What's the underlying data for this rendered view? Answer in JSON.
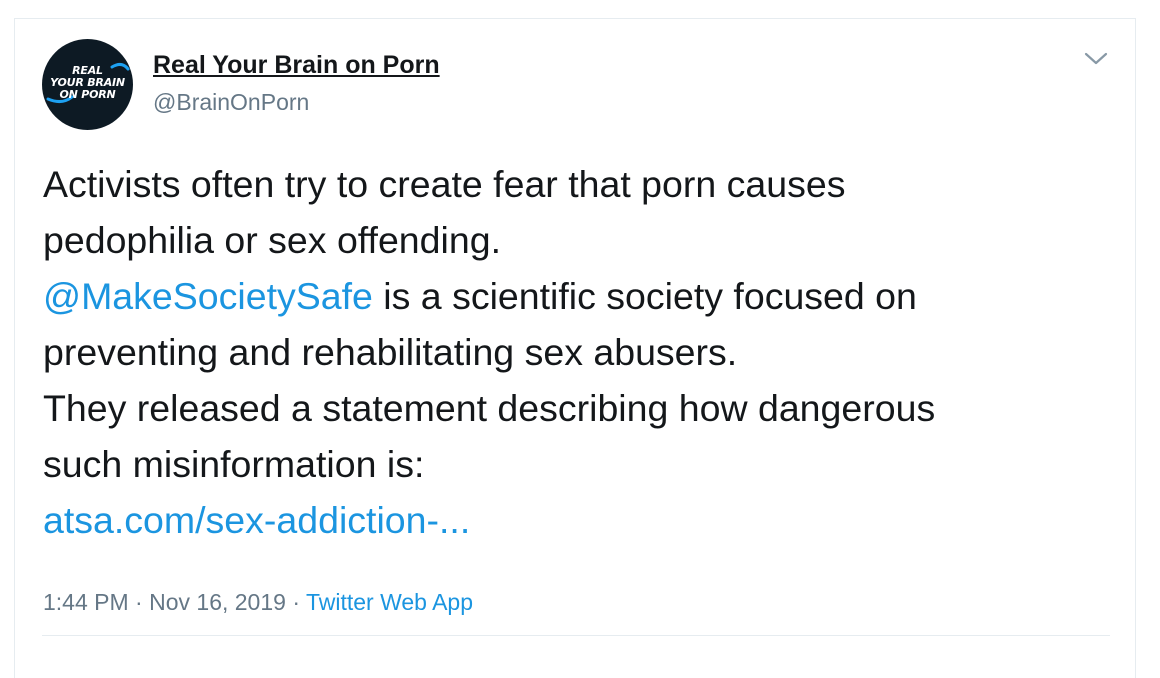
{
  "user": {
    "avatar_text_lines": [
      "REAL",
      "YOUR BRAIN",
      "ON PORN"
    ],
    "display_name": "Real Your Brain on Porn",
    "handle": "@BrainOnPorn"
  },
  "tweet": {
    "line1": "Activists often try to create fear that porn causes",
    "line2": "pedophilia or sex offending.",
    "mention": "@MakeSocietySafe",
    "line3_rest": " is a scientific society focused on",
    "line4": "preventing and rehabilitating sex abusers.",
    "line5": "They released a statement describing how dangerous",
    "line6": "such misinformation is:",
    "link": "atsa.com/sex-addiction-..."
  },
  "meta": {
    "time": "1:44 PM",
    "separator": " · ",
    "date": "Nov 16, 2019",
    "source": "Twitter Web App"
  },
  "icons": {
    "more": "chevron-down-icon"
  },
  "colors": {
    "link": "#1b95e0",
    "secondary": "#657786",
    "text": "#14171a",
    "avatar_bg": "#0d1a24",
    "avatar_accent": "#1da1f2"
  }
}
